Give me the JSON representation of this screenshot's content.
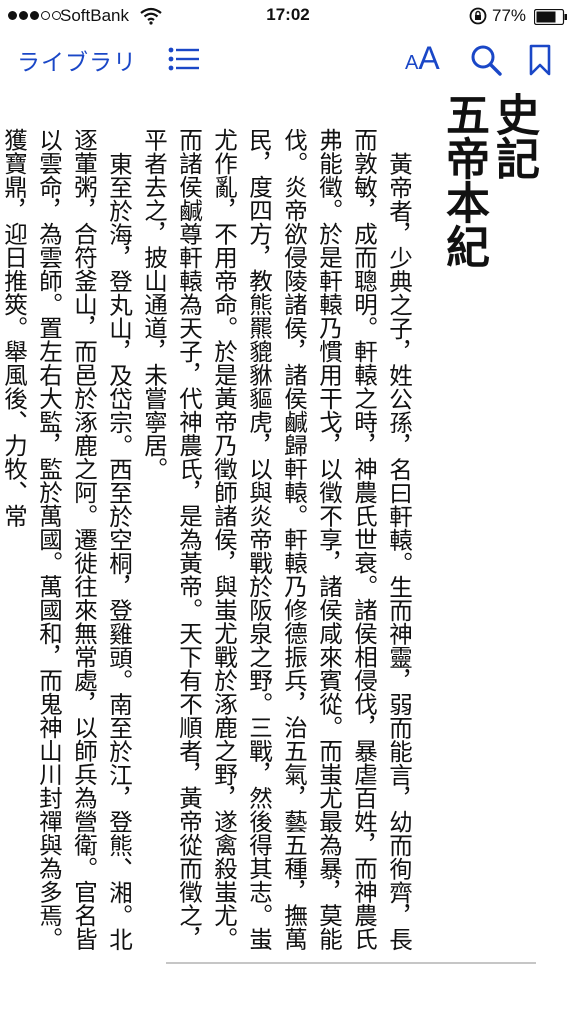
{
  "status_bar": {
    "carrier": "SoftBank",
    "time": "17:02",
    "battery": "77%"
  },
  "nav": {
    "library": "ライブラリ",
    "font_small": "A",
    "font_large": "A",
    "icons": [
      "toc-icon",
      "search-icon",
      "bookmark-icon"
    ]
  },
  "book": {
    "title_line1": "史記",
    "title_line2": "五帝本紀",
    "paragraphs": [
      "黃帝者，少典之子，姓公孫，名曰軒轅。生而神靈，弱而能言，幼而徇齊，長而敦敏，成而聰明。軒轅之時，神農氏世衰。諸侯相侵伐，暴虐百姓，而神農氏弗能徵。於是軒轅乃慣用干戈，以徵不享，諸侯咸來賓從。而蚩尤最為暴，莫能伐。炎帝欲侵陵諸侯，諸侯鹹歸軒轅。軒轅乃修德振兵，治五氣，藝五種，撫萬民，度四方，教熊羆貔貅貙虎，以與炎帝戰於阪泉之野。三戰，然後得其志。蚩尤作亂，不用帝命。於是黃帝乃徵師諸侯，與蚩尤戰於涿鹿之野，遂禽殺蚩尤。而諸侯鹹尊軒轅為天子，代神農氏，是為黃帝。天下有不順者，黃帝從而徵之，平者去之，披山通道，未嘗寧居。",
      "東至於海，登丸山，及岱宗。西至於空桐，登雞頭。南至於江，登熊、湘。北逐葷粥，合符釜山，而邑於涿鹿之阿。遷徙往來無常處，以師兵為營衛。官名皆以雲命，為雲師。置左右大監，監於萬國。萬國和，而鬼神山川封禪與為多焉。獲寶鼎，迎日推筴。舉風後、力牧、常"
    ]
  }
}
